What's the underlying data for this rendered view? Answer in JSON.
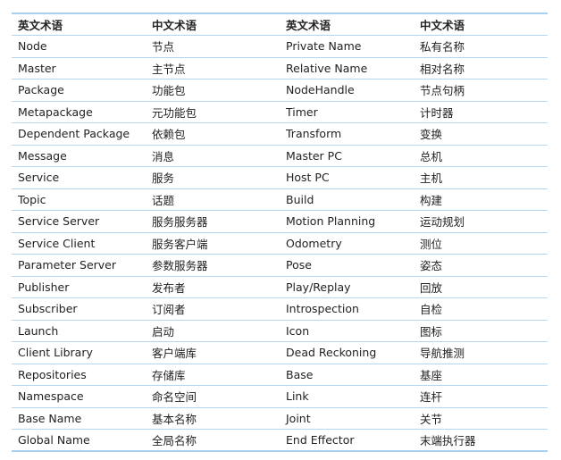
{
  "headers": [
    "英文术语",
    "中文术语",
    "英文术语",
    "中文术语"
  ],
  "rows": [
    [
      "Node",
      "节点",
      "Private Name",
      "私有名称"
    ],
    [
      "Master",
      "主节点",
      "Relative Name",
      "相对名称"
    ],
    [
      "Package",
      "功能包",
      "NodeHandle",
      "节点句柄"
    ],
    [
      "Metapackage",
      "元功能包",
      "Timer",
      "计时器"
    ],
    [
      "Dependent Package",
      "依赖包",
      "Transform",
      "变换"
    ],
    [
      "Message",
      "消息",
      "Master PC",
      "总机"
    ],
    [
      "Service",
      "服务",
      "Host PC",
      "主机"
    ],
    [
      "Topic",
      "话题",
      "Build",
      "构建"
    ],
    [
      "Service Server",
      "服务服务器",
      "Motion Planning",
      "运动规划"
    ],
    [
      "Service Client",
      "服务客户端",
      "Odometry",
      "测位"
    ],
    [
      "Parameter Server",
      "参数服务器",
      "Pose",
      "姿态"
    ],
    [
      "Publisher",
      "发布者",
      "Play/Replay",
      "回放"
    ],
    [
      "Subscriber",
      "订阅者",
      "Introspection",
      "自检"
    ],
    [
      "Launch",
      "启动",
      "Icon",
      "图标"
    ],
    [
      "Client Library",
      "客户端库",
      "Dead Reckoning",
      "导航推测"
    ],
    [
      "Repositories",
      "存储库",
      "Base",
      "基座"
    ],
    [
      "Namespace",
      "命名空间",
      "Link",
      "连杆"
    ],
    [
      "Base Name",
      "基本名称",
      "Joint",
      "关节"
    ],
    [
      "Global Name",
      "全局名称",
      "End Effector",
      "末端执行器"
    ]
  ]
}
